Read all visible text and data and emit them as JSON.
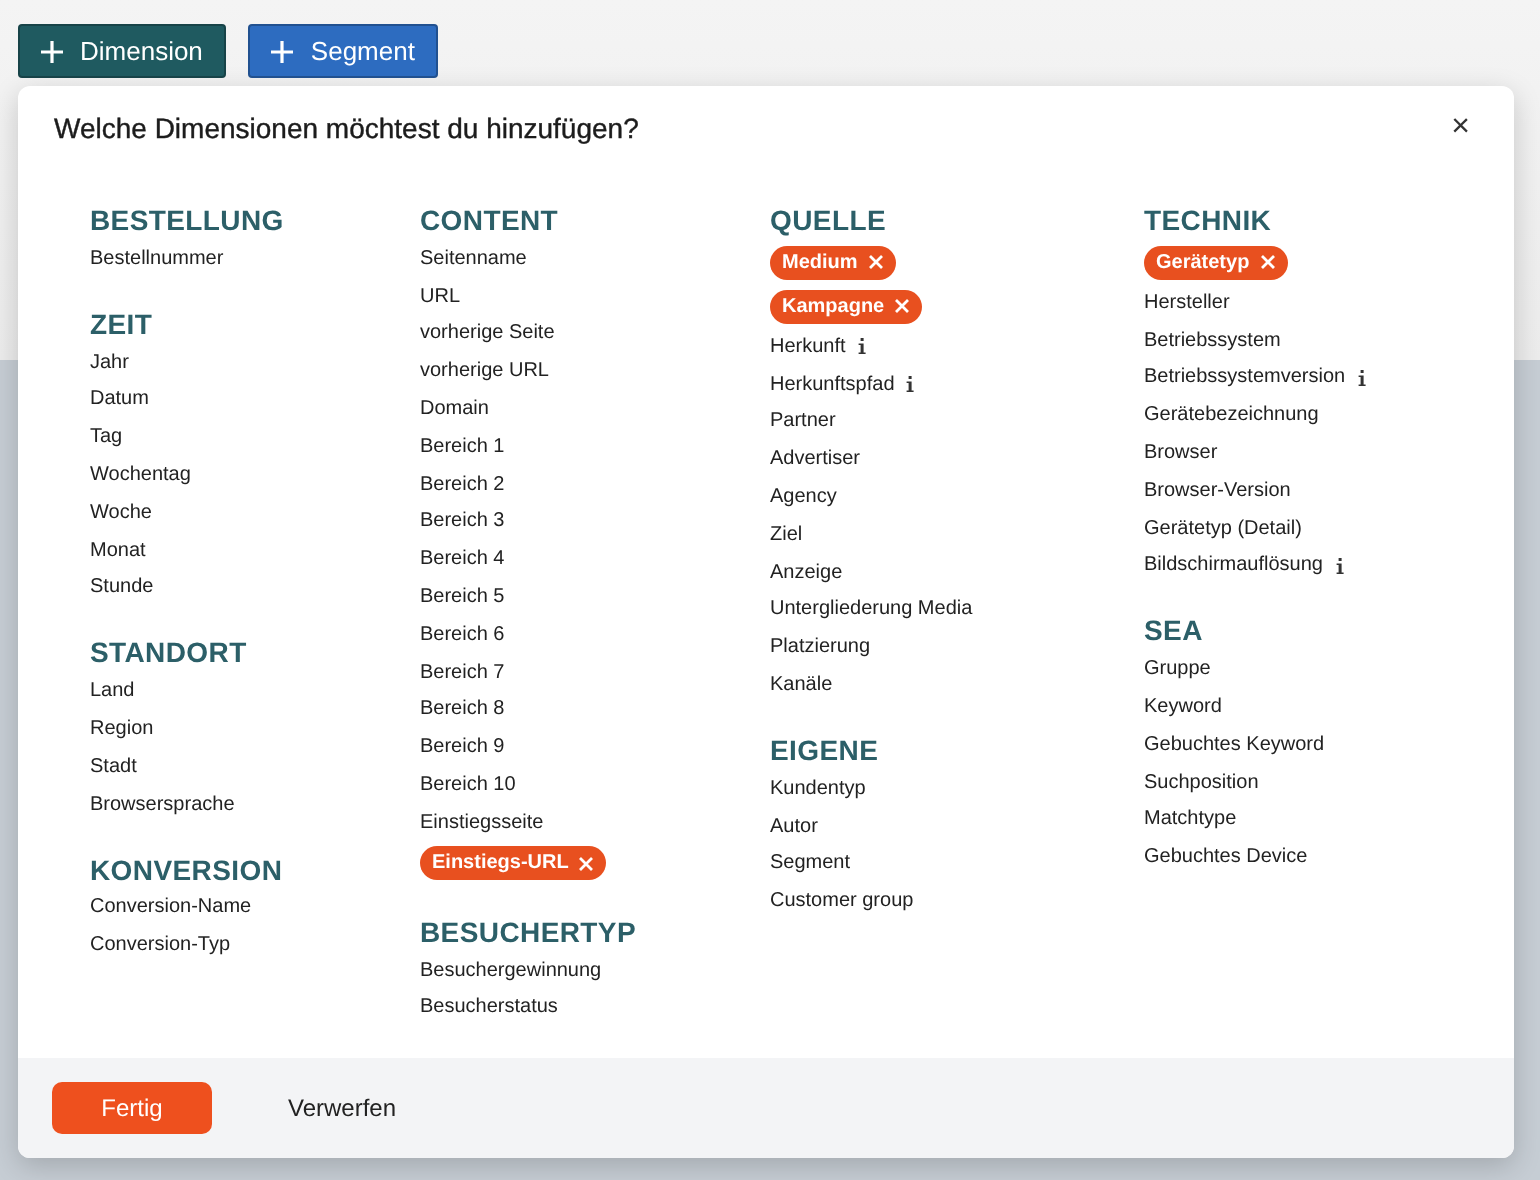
{
  "toolbar": {
    "buttons": [
      {
        "label": "Dimension",
        "kind": "dimension"
      },
      {
        "label": "Segment",
        "kind": "segment"
      }
    ]
  },
  "dialog": {
    "title": "Welche Dimensionen möchtest du hinzufügen?",
    "close": "×",
    "columns": [
      {
        "groups": [
          {
            "title": "BESTELLUNG",
            "items": [
              {
                "label": "Bestellnummer",
                "selected": false,
                "info": false
              }
            ]
          },
          {
            "title": "ZEIT",
            "items": [
              {
                "label": "Jahr",
                "selected": false,
                "info": false
              },
              {
                "label": "Datum",
                "selected": false,
                "info": false
              },
              {
                "label": "Tag",
                "selected": false,
                "info": false
              },
              {
                "label": "Wochentag",
                "selected": false,
                "info": false
              },
              {
                "label": "Woche",
                "selected": false,
                "info": false
              },
              {
                "label": "Monat",
                "selected": false,
                "info": false
              },
              {
                "label": "Stunde",
                "selected": false,
                "info": false
              }
            ]
          },
          {
            "title": "STANDORT",
            "items": [
              {
                "label": "Land",
                "selected": false,
                "info": false
              },
              {
                "label": "Region",
                "selected": false,
                "info": false
              },
              {
                "label": "Stadt",
                "selected": false,
                "info": false
              },
              {
                "label": "Browsersprache",
                "selected": false,
                "info": false
              }
            ]
          },
          {
            "title": "KONVERSION",
            "items": [
              {
                "label": "Conversion-Name",
                "selected": false,
                "info": false
              },
              {
                "label": "Conversion-Typ",
                "selected": false,
                "info": false
              }
            ]
          }
        ]
      },
      {
        "groups": [
          {
            "title": "CONTENT",
            "items": [
              {
                "label": "Seitenname",
                "selected": false,
                "info": false
              },
              {
                "label": "URL",
                "selected": false,
                "info": false
              },
              {
                "label": "vorherige Seite",
                "selected": false,
                "info": false
              },
              {
                "label": "vorherige URL",
                "selected": false,
                "info": false
              },
              {
                "label": "Domain",
                "selected": false,
                "info": false
              },
              {
                "label": "Bereich 1",
                "selected": false,
                "info": false
              },
              {
                "label": "Bereich 2",
                "selected": false,
                "info": false
              },
              {
                "label": "Bereich 3",
                "selected": false,
                "info": false
              },
              {
                "label": "Bereich 4",
                "selected": false,
                "info": false
              },
              {
                "label": "Bereich 5",
                "selected": false,
                "info": false
              },
              {
                "label": "Bereich 6",
                "selected": false,
                "info": false
              },
              {
                "label": "Bereich 7",
                "selected": false,
                "info": false
              },
              {
                "label": "Bereich 8",
                "selected": false,
                "info": false
              },
              {
                "label": "Bereich 9",
                "selected": false,
                "info": false
              },
              {
                "label": "Bereich 10",
                "selected": false,
                "info": false
              },
              {
                "label": "Einstiegsseite",
                "selected": false,
                "info": false
              },
              {
                "label": "Einstiegs-URL",
                "selected": true,
                "info": false
              }
            ]
          },
          {
            "title": "BESUCHERTYP",
            "items": [
              {
                "label": "Besuchergewinnung",
                "selected": false,
                "info": false
              },
              {
                "label": "Besucherstatus",
                "selected": false,
                "info": false
              }
            ]
          }
        ]
      },
      {
        "groups": [
          {
            "title": "QUELLE",
            "items": [
              {
                "label": "Medium",
                "selected": true,
                "info": false
              },
              {
                "label": "Kampagne",
                "selected": true,
                "info": false
              },
              {
                "label": "Herkunft",
                "selected": false,
                "info": true
              },
              {
                "label": "Herkunftspfad",
                "selected": false,
                "info": true
              },
              {
                "label": "Partner",
                "selected": false,
                "info": false
              },
              {
                "label": "Advertiser",
                "selected": false,
                "info": false
              },
              {
                "label": "Agency",
                "selected": false,
                "info": false
              },
              {
                "label": "Ziel",
                "selected": false,
                "info": false
              },
              {
                "label": "Anzeige",
                "selected": false,
                "info": false
              },
              {
                "label": "Untergliederung Media",
                "selected": false,
                "info": false
              },
              {
                "label": "Platzierung",
                "selected": false,
                "info": false
              },
              {
                "label": "Kanäle",
                "selected": false,
                "info": false
              }
            ]
          },
          {
            "title": "EIGENE",
            "items": [
              {
                "label": "Kundentyp",
                "selected": false,
                "info": false
              },
              {
                "label": "Autor",
                "selected": false,
                "info": false
              },
              {
                "label": "Segment",
                "selected": false,
                "info": false
              },
              {
                "label": "Customer group",
                "selected": false,
                "info": false
              }
            ]
          }
        ]
      },
      {
        "groups": [
          {
            "title": "TECHNIK",
            "items": [
              {
                "label": "Gerätetyp",
                "selected": true,
                "info": false
              },
              {
                "label": "Hersteller",
                "selected": false,
                "info": false
              },
              {
                "label": "Betriebssystem",
                "selected": false,
                "info": false
              },
              {
                "label": "Betriebssystemversion",
                "selected": false,
                "info": true
              },
              {
                "label": "Gerätebezeichnung",
                "selected": false,
                "info": false
              },
              {
                "label": "Browser",
                "selected": false,
                "info": false
              },
              {
                "label": "Browser-Version",
                "selected": false,
                "info": false
              },
              {
                "label": "Gerätetyp (Detail)",
                "selected": false,
                "info": false
              },
              {
                "label": "Bildschirmauflösung",
                "selected": false,
                "info": true
              }
            ]
          },
          {
            "title": "SEA",
            "items": [
              {
                "label": "Gruppe",
                "selected": false,
                "info": false
              },
              {
                "label": "Keyword",
                "selected": false,
                "info": false
              },
              {
                "label": "Gebuchtes Keyword",
                "selected": false,
                "info": false
              },
              {
                "label": "Suchposition",
                "selected": false,
                "info": false
              },
              {
                "label": "Matchtype",
                "selected": false,
                "info": false
              },
              {
                "label": "Gebuchtes Device",
                "selected": false,
                "info": false
              }
            ]
          }
        ]
      }
    ],
    "footer": {
      "buttons": [
        {
          "label": "Fertig",
          "kind": "primary"
        },
        {
          "label": "Verwerfen",
          "kind": "secondary"
        }
      ]
    }
  }
}
